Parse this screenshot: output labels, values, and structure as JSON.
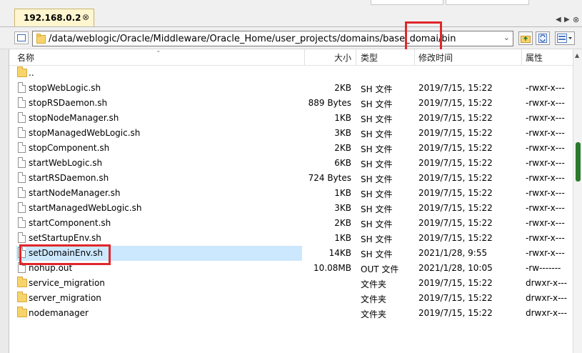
{
  "tab": {
    "title": "192.168.0.2",
    "close": "⊗"
  },
  "tabnav": {
    "left": "◀",
    "right": "▶",
    "close": "⊗"
  },
  "address": {
    "path_prefix": "/data/weblogic/Oracle/Middleware/Oracle_Home/user_projects/domains/base_domai",
    "path_suffix": "/bin"
  },
  "columns": {
    "name": "名称",
    "size": "大小",
    "type": "类型",
    "modified": "修改时间",
    "attrs": "属性"
  },
  "rows": [
    {
      "kind": "folder",
      "name": "..",
      "size": "",
      "type": "",
      "modified": "",
      "attrs": ""
    },
    {
      "kind": "file",
      "name": "stopWebLogic.sh",
      "size": "2KB",
      "type": "SH 文件",
      "modified": "2019/7/15, 15:22",
      "attrs": "-rwxr-x---"
    },
    {
      "kind": "file",
      "name": "stopRSDaemon.sh",
      "size": "889 Bytes",
      "type": "SH 文件",
      "modified": "2019/7/15, 15:22",
      "attrs": "-rwxr-x---"
    },
    {
      "kind": "file",
      "name": "stopNodeManager.sh",
      "size": "1KB",
      "type": "SH 文件",
      "modified": "2019/7/15, 15:22",
      "attrs": "-rwxr-x---"
    },
    {
      "kind": "file",
      "name": "stopManagedWebLogic.sh",
      "size": "3KB",
      "type": "SH 文件",
      "modified": "2019/7/15, 15:22",
      "attrs": "-rwxr-x---"
    },
    {
      "kind": "file",
      "name": "stopComponent.sh",
      "size": "2KB",
      "type": "SH 文件",
      "modified": "2019/7/15, 15:22",
      "attrs": "-rwxr-x---"
    },
    {
      "kind": "file",
      "name": "startWebLogic.sh",
      "size": "6KB",
      "type": "SH 文件",
      "modified": "2019/7/15, 15:22",
      "attrs": "-rwxr-x---"
    },
    {
      "kind": "file",
      "name": "startRSDaemon.sh",
      "size": "724 Bytes",
      "type": "SH 文件",
      "modified": "2019/7/15, 15:22",
      "attrs": "-rwxr-x---"
    },
    {
      "kind": "file",
      "name": "startNodeManager.sh",
      "size": "1KB",
      "type": "SH 文件",
      "modified": "2019/7/15, 15:22",
      "attrs": "-rwxr-x---"
    },
    {
      "kind": "file",
      "name": "startManagedWebLogic.sh",
      "size": "3KB",
      "type": "SH 文件",
      "modified": "2019/7/15, 15:22",
      "attrs": "-rwxr-x---"
    },
    {
      "kind": "file",
      "name": "startComponent.sh",
      "size": "2KB",
      "type": "SH 文件",
      "modified": "2019/7/15, 15:22",
      "attrs": "-rwxr-x---"
    },
    {
      "kind": "file",
      "name": "setStartupEnv.sh",
      "size": "1KB",
      "type": "SH 文件",
      "modified": "2019/7/15, 15:22",
      "attrs": "-rwxr-x---"
    },
    {
      "kind": "file",
      "name": "setDomainEnv.sh",
      "size": "14KB",
      "type": "SH 文件",
      "modified": "2021/1/28, 9:55",
      "attrs": "-rwxr-x---",
      "selected": true
    },
    {
      "kind": "file",
      "name": "nohup.out",
      "size": "10.08MB",
      "type": "OUT 文件",
      "modified": "2021/1/28, 10:05",
      "attrs": "-rw-------"
    },
    {
      "kind": "folder",
      "name": "service_migration",
      "size": "",
      "type": "文件夹",
      "modified": "2019/7/15, 15:22",
      "attrs": "drwxr-x---"
    },
    {
      "kind": "folder",
      "name": "server_migration",
      "size": "",
      "type": "文件夹",
      "modified": "2019/7/15, 15:22",
      "attrs": "drwxr-x---"
    },
    {
      "kind": "folder",
      "name": "nodemanager",
      "size": "",
      "type": "文件夹",
      "modified": "2019/7/15, 15:22",
      "attrs": "drwxr-x---"
    }
  ],
  "colors": {
    "highlight": "#e0262b",
    "selection": "#cce8ff",
    "tab": "#fff6cf",
    "scroll_thumb": "#2c7a2c"
  }
}
